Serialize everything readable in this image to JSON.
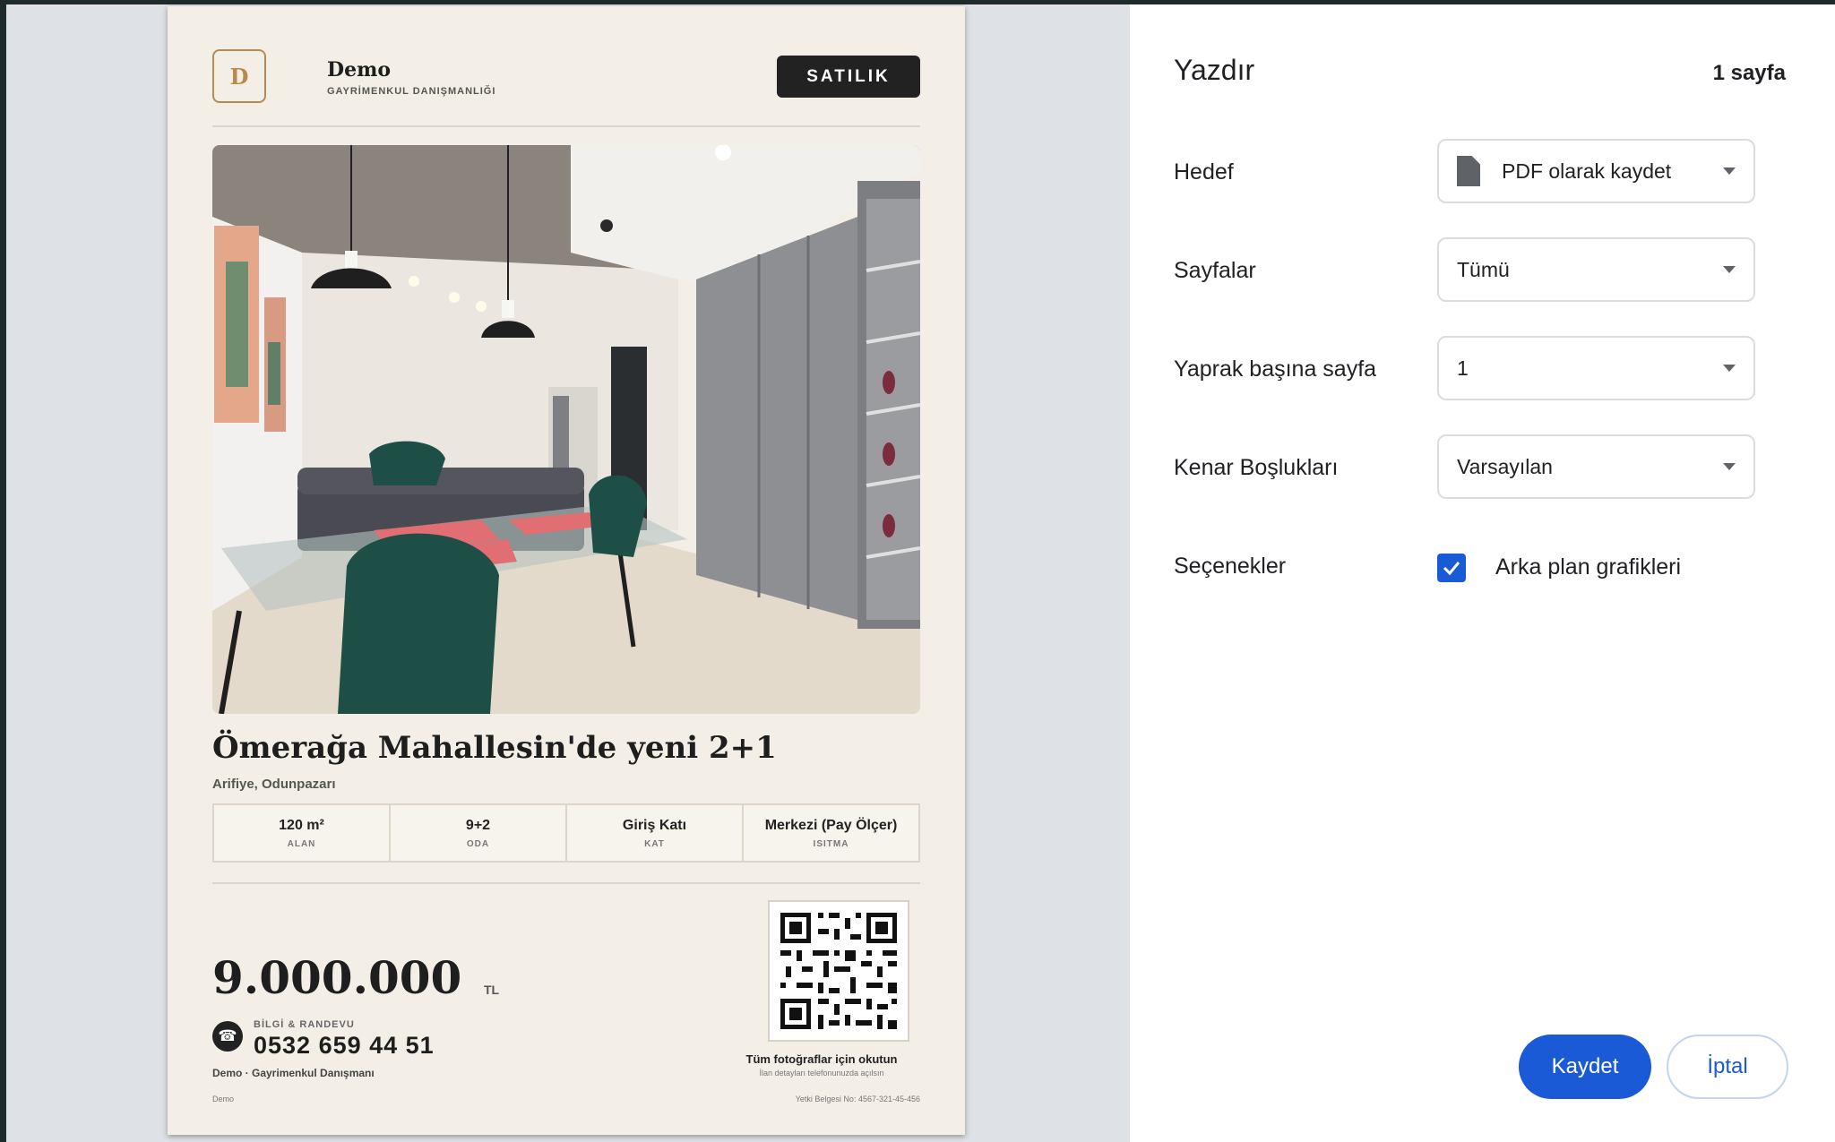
{
  "listing": {
    "logo_letter": "D",
    "brand_name": "Demo",
    "brand_subtitle": "GAYRİMENKUL DANIŞMANLIĞI",
    "badge": "SATILIK",
    "title": "Ömerağa Mahallesin'de yeni 2+1",
    "location": "Arifiye, Odunpazarı",
    "features": [
      {
        "value": "120 m²",
        "label": "ALAN"
      },
      {
        "value": "9+2",
        "label": "ODA"
      },
      {
        "value": "Giriş Katı",
        "label": "KAT"
      },
      {
        "value": "Merkezi (Pay Ölçer)",
        "label": "ISITMA"
      }
    ],
    "price": "9.000.000",
    "currency": "TL",
    "contact_label": "BİLGİ & RANDEVU",
    "phone": "0532 659 44 51",
    "company_line": "Demo · Gayrimenkul Danışmanı",
    "footer_left": "Demo",
    "footer_right": "Yetki Belgesi No: 4567-321-45-456",
    "qr_caption": "Tüm fotoğraflar için okutun",
    "qr_subcaption": "İlan detayları telefonunuzda açılsın"
  },
  "print": {
    "title": "Yazdır",
    "page_count": "1 sayfa",
    "rows": {
      "destination": {
        "label": "Hedef",
        "value": "PDF olarak kaydet"
      },
      "pages": {
        "label": "Sayfalar",
        "value": "Tümü"
      },
      "pages_per_sheet": {
        "label": "Yaprak başına sayfa",
        "value": "1"
      },
      "margins": {
        "label": "Kenar Boşlukları",
        "value": "Varsayılan"
      },
      "options": {
        "label": "Seçenekler",
        "checkbox_label": "Arka plan grafikleri",
        "checked": true
      }
    },
    "save_button": "Kaydet",
    "cancel_button": "İptal"
  },
  "colors": {
    "accent": "#1a5ad7",
    "page_bg": "#f3efe6",
    "brand_gold": "#b98a4e"
  }
}
